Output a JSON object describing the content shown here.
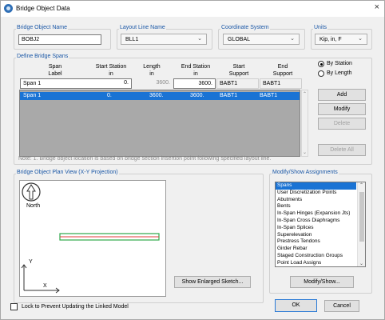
{
  "window": {
    "title": "Bridge Object Data",
    "close_glyph": "×"
  },
  "bridge_object_name": {
    "label": "Bridge Object Name",
    "value": "BOBJ2"
  },
  "layout_line_name": {
    "label": "Layout Line Name",
    "value": "BLL1"
  },
  "coordinate_system": {
    "label": "Coordinate System",
    "value": "GLOBAL"
  },
  "units": {
    "label": "Units",
    "value": "Kip, in, F"
  },
  "define_spans": {
    "label": "Define Bridge Spans",
    "headers": {
      "span_label": "Span\nLabel",
      "start_station": "Start Station\nin",
      "length": "Length\nin",
      "end_station": "End Station\nin",
      "start_support": "Start\nSupport",
      "end_support": "End\nSupport"
    },
    "edit_row": {
      "span_label": "Span 1",
      "start_station": "0.",
      "length": "3600.",
      "end_station": "3600.",
      "start_support": "BABT1",
      "end_support": "BABT1"
    },
    "rows": [
      {
        "span_label": "Span 1",
        "start_station": "0.",
        "length": "3600.",
        "end_station": "3600.",
        "start_support": "BABT1",
        "end_support": "BABT1"
      }
    ],
    "radio_by_station": "By Station",
    "radio_by_length": "By Length",
    "radio_selected": "By Station",
    "add_button": "Add",
    "modify_button": "Modify",
    "delete_button": "Delete",
    "delete_all_button": "Delete All",
    "note": "Note:  1. Bridge object location is based on bridge section insertion point following specified layout line."
  },
  "plan_view": {
    "label": "Bridge Object Plan View (X-Y Projection)",
    "north_label": "North",
    "axis_y": "Y",
    "axis_x": "X",
    "enlarge_button": "Show Enlarged Sketch..."
  },
  "assignments": {
    "label": "Modify/Show Assignments",
    "items": [
      "Spans",
      "User Discretization Points",
      "Abutments",
      "Bents",
      "In-Span Hinges (Expansion Jts)",
      "In-Span Cross Diaphragms",
      "In-Span Splices",
      "Superelevation",
      "Prestress Tendons",
      "Girder Rebar",
      "Staged Construction Groups",
      "Point Load Assigns"
    ],
    "selected": "Spans",
    "button": "Modify/Show..."
  },
  "lock_label": "Lock to Prevent Updating the Linked Model",
  "ok_button": "OK",
  "cancel_button": "Cancel",
  "colors": {
    "accent": "#1a57a6",
    "selection": "#1a73d4",
    "deck_line_green": "#2ea84a",
    "deck_line_red": "#e23b3b"
  }
}
